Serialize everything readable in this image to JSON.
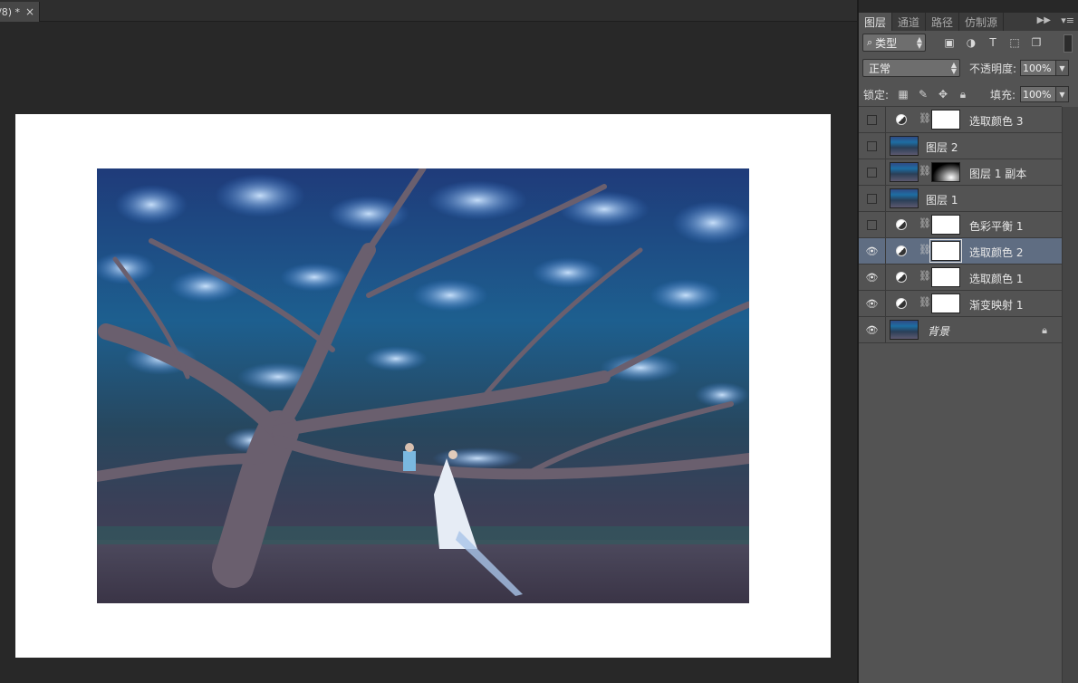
{
  "document": {
    "tab_title": "/8) *",
    "close_glyph": "×"
  },
  "layers_panel": {
    "tabs": [
      "图层",
      "通道",
      "路径",
      "仿制源"
    ],
    "active_tab": 0,
    "filter": {
      "label": "类型"
    },
    "blend_mode": "正常",
    "opacity_label": "不透明度:",
    "opacity_value": "100%",
    "lock_label": "锁定:",
    "fill_label": "填充:",
    "fill_value": "100%",
    "layers": [
      {
        "name": "选取颜色 3",
        "kind": "adjustment",
        "visible": false,
        "selected": false
      },
      {
        "name": "图层 2",
        "kind": "image",
        "visible": false,
        "selected": false
      },
      {
        "name": "图层 1 副本",
        "kind": "image-mask",
        "visible": false,
        "selected": false
      },
      {
        "name": "图层 1",
        "kind": "image",
        "visible": false,
        "selected": false
      },
      {
        "name": "色彩平衡 1",
        "kind": "adjustment",
        "visible": false,
        "selected": false
      },
      {
        "name": "选取颜色 2",
        "kind": "adjustment",
        "visible": true,
        "selected": true
      },
      {
        "name": "选取颜色 1",
        "kind": "adjustment",
        "visible": true,
        "selected": false
      },
      {
        "name": "渐变映射 1",
        "kind": "adjustment",
        "visible": true,
        "selected": false
      },
      {
        "name": "背景",
        "kind": "background",
        "visible": true,
        "selected": false,
        "locked": true
      }
    ]
  },
  "colors": {
    "app_bg": "#282828",
    "panel_bg": "#535353",
    "selected_row": "#5f6d82"
  }
}
